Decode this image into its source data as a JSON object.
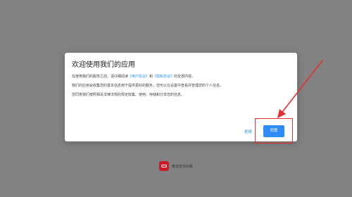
{
  "dialog": {
    "title": "欢迎使用我们的应用",
    "paragraph1": {
      "prefix": "在使用我们的服务之前，请仔细阅读",
      "user_agreement": "《用户协议》",
      "conjunction": "和",
      "privacy_policy": "《隐私协议》",
      "suffix": "的全部内容。"
    },
    "paragraph2": "我们的应用会收集您的基本信息用于提供更好的服务，您可以在设置中查看并管理您的个人信息。",
    "paragraph3": "您同意我们按照相关法律法规的规定收集、使用、存储和分享您的信息。",
    "reject_label": "拒绝",
    "agree_label": "同意"
  },
  "app": {
    "name": "黄道吉日AI版",
    "logo_color": "#c81e2c"
  },
  "colors": {
    "overlay": "#828282",
    "link": "#1a8cff",
    "primary_button": "#2f8cf7",
    "annotation": "#e53030"
  },
  "icons": {
    "app_logo": "app-logo-icon",
    "annotation_arrow": "red-arrow-icon"
  }
}
